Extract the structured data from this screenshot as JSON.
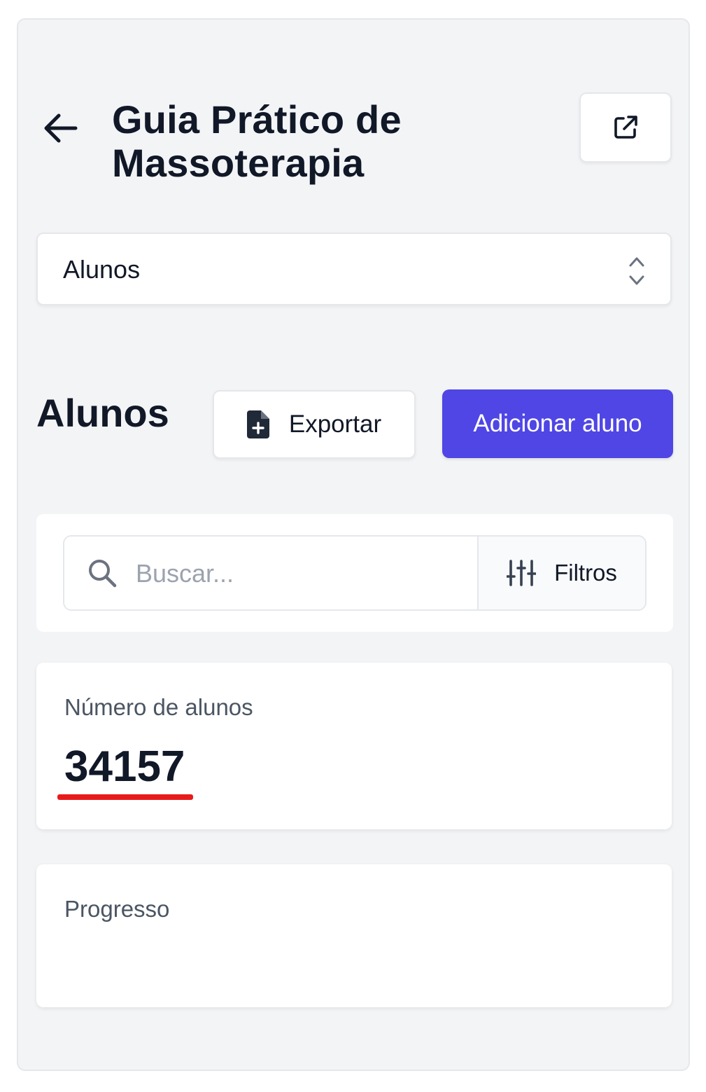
{
  "header": {
    "title": "Guia Prático de Massoterapia",
    "back_icon": "arrow-left-icon",
    "open_icon": "external-link-icon"
  },
  "selector": {
    "value": "Alunos",
    "icon": "chevron-up-down-icon"
  },
  "section": {
    "title": "Alunos",
    "export_label": "Exportar",
    "export_icon": "file-plus-icon",
    "add_label": "Adicionar aluno",
    "accent_color": "#4f46e5"
  },
  "search": {
    "placeholder": "Buscar...",
    "value": "",
    "icon": "search-icon",
    "filter_label": "Filtros",
    "filter_icon": "sliders-icon"
  },
  "stats": {
    "students_label": "Número de alunos",
    "students_value": "34157",
    "progress_label": "Progresso"
  }
}
